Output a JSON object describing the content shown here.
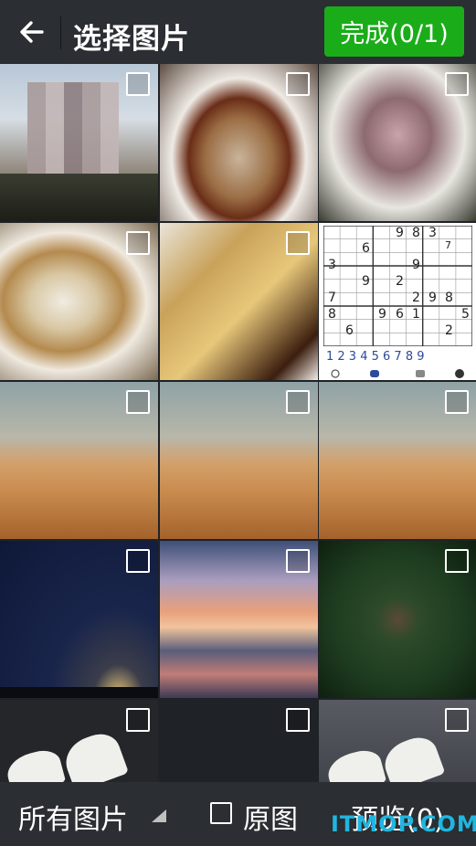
{
  "header": {
    "back_icon": "arrow-left-icon",
    "title": "选择图片",
    "done_label": "完成(0/1)",
    "done_color": "#1aad19"
  },
  "photos": [
    {
      "name": "couple-photo"
    },
    {
      "name": "steamed-fish-photo"
    },
    {
      "name": "squid-dish-photo"
    },
    {
      "name": "shellfish-photo"
    },
    {
      "name": "yellow-croaker-photo"
    },
    {
      "name": "sudoku-screenshot"
    },
    {
      "name": "desert-photo-1"
    },
    {
      "name": "desert-photo-2"
    },
    {
      "name": "desert-photo-3"
    },
    {
      "name": "starry-sky-photo"
    },
    {
      "name": "sunset-beach-photo"
    },
    {
      "name": "forest-aerial-photo"
    },
    {
      "name": "sneakers-photo-1"
    },
    {
      "name": "empty-thumbnail"
    },
    {
      "name": "sneakers-photo-2"
    }
  ],
  "sudoku": {
    "cells": [
      {
        "text": "9"
      },
      {
        "text": "8"
      },
      {
        "text": "3"
      },
      {
        "text": "6"
      },
      {
        "text": "7"
      },
      {
        "text": "3"
      },
      {
        "text": "9"
      },
      {
        "text": "9"
      },
      {
        "text": "2"
      },
      {
        "text": "7"
      },
      {
        "text": "2"
      },
      {
        "text": "9"
      },
      {
        "text": "8"
      },
      {
        "text": "8"
      },
      {
        "text": "9"
      },
      {
        "text": "6"
      },
      {
        "text": "1"
      },
      {
        "text": "5"
      },
      {
        "text": "6"
      },
      {
        "text": "2"
      }
    ],
    "number_pad": "1 2 3 4 5 6 7 8 9"
  },
  "bottom": {
    "album_label": "所有图片",
    "original_label": "原图",
    "preview_label": "预览(0)"
  },
  "watermark": "ITMOP.COM"
}
